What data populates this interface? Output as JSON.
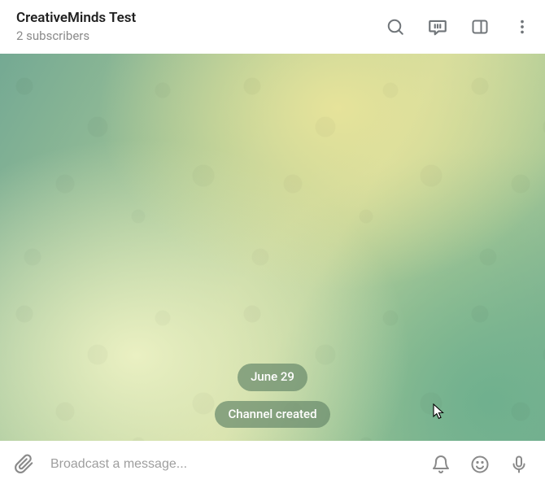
{
  "header": {
    "title": "CreativeMinds Test",
    "subtitle": "2 subscribers"
  },
  "messages": {
    "date_label": "June 29",
    "system_message": "Channel created"
  },
  "composer": {
    "placeholder": "Broadcast a message..."
  }
}
